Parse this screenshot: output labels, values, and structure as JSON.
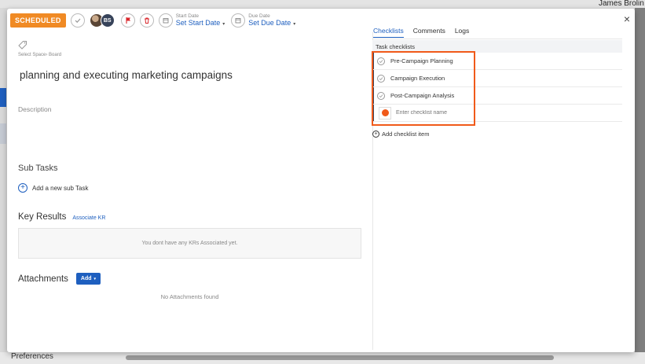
{
  "background": {
    "user_name": "James Brolin",
    "preferences_label": "Preferences"
  },
  "toolbar": {
    "status_label": "SCHEDULED",
    "assignee_initials": "BS",
    "start_date_label": "Start Date",
    "start_date_value": "Set Start Date",
    "due_date_label": "Due Date",
    "due_date_value": "Set Due Date",
    "close_symbol": "×",
    "caret": "▾"
  },
  "task": {
    "space_board_label": "Select Space› Board",
    "title": "planning and executing marketing campaigns",
    "description_label": "Description"
  },
  "subtasks": {
    "title": "Sub Tasks",
    "add_label": "Add a new sub Task"
  },
  "key_results": {
    "title": "Key Results",
    "associate_link": "Associate KR",
    "empty_message": "You dont have any KRs Associated yet."
  },
  "attachments": {
    "title": "Attachments",
    "add_label": "Add",
    "empty_message": "No Attachments found"
  },
  "tabs": [
    {
      "label": "Checklists",
      "active": true
    },
    {
      "label": "Comments",
      "active": false
    },
    {
      "label": "Logs",
      "active": false
    }
  ],
  "checklist": {
    "header": "Task checklists",
    "items": [
      {
        "label": "Pre-Campaign Planning"
      },
      {
        "label": "Campaign Execution"
      },
      {
        "label": "Post-Campaign Analysis"
      }
    ],
    "new_placeholder": "Enter checklist name",
    "add_label": "Add checklist item"
  },
  "colors": {
    "accent": "#1e5fbf",
    "status_orange": "#f08a24",
    "highlight": "#f05a1a"
  }
}
